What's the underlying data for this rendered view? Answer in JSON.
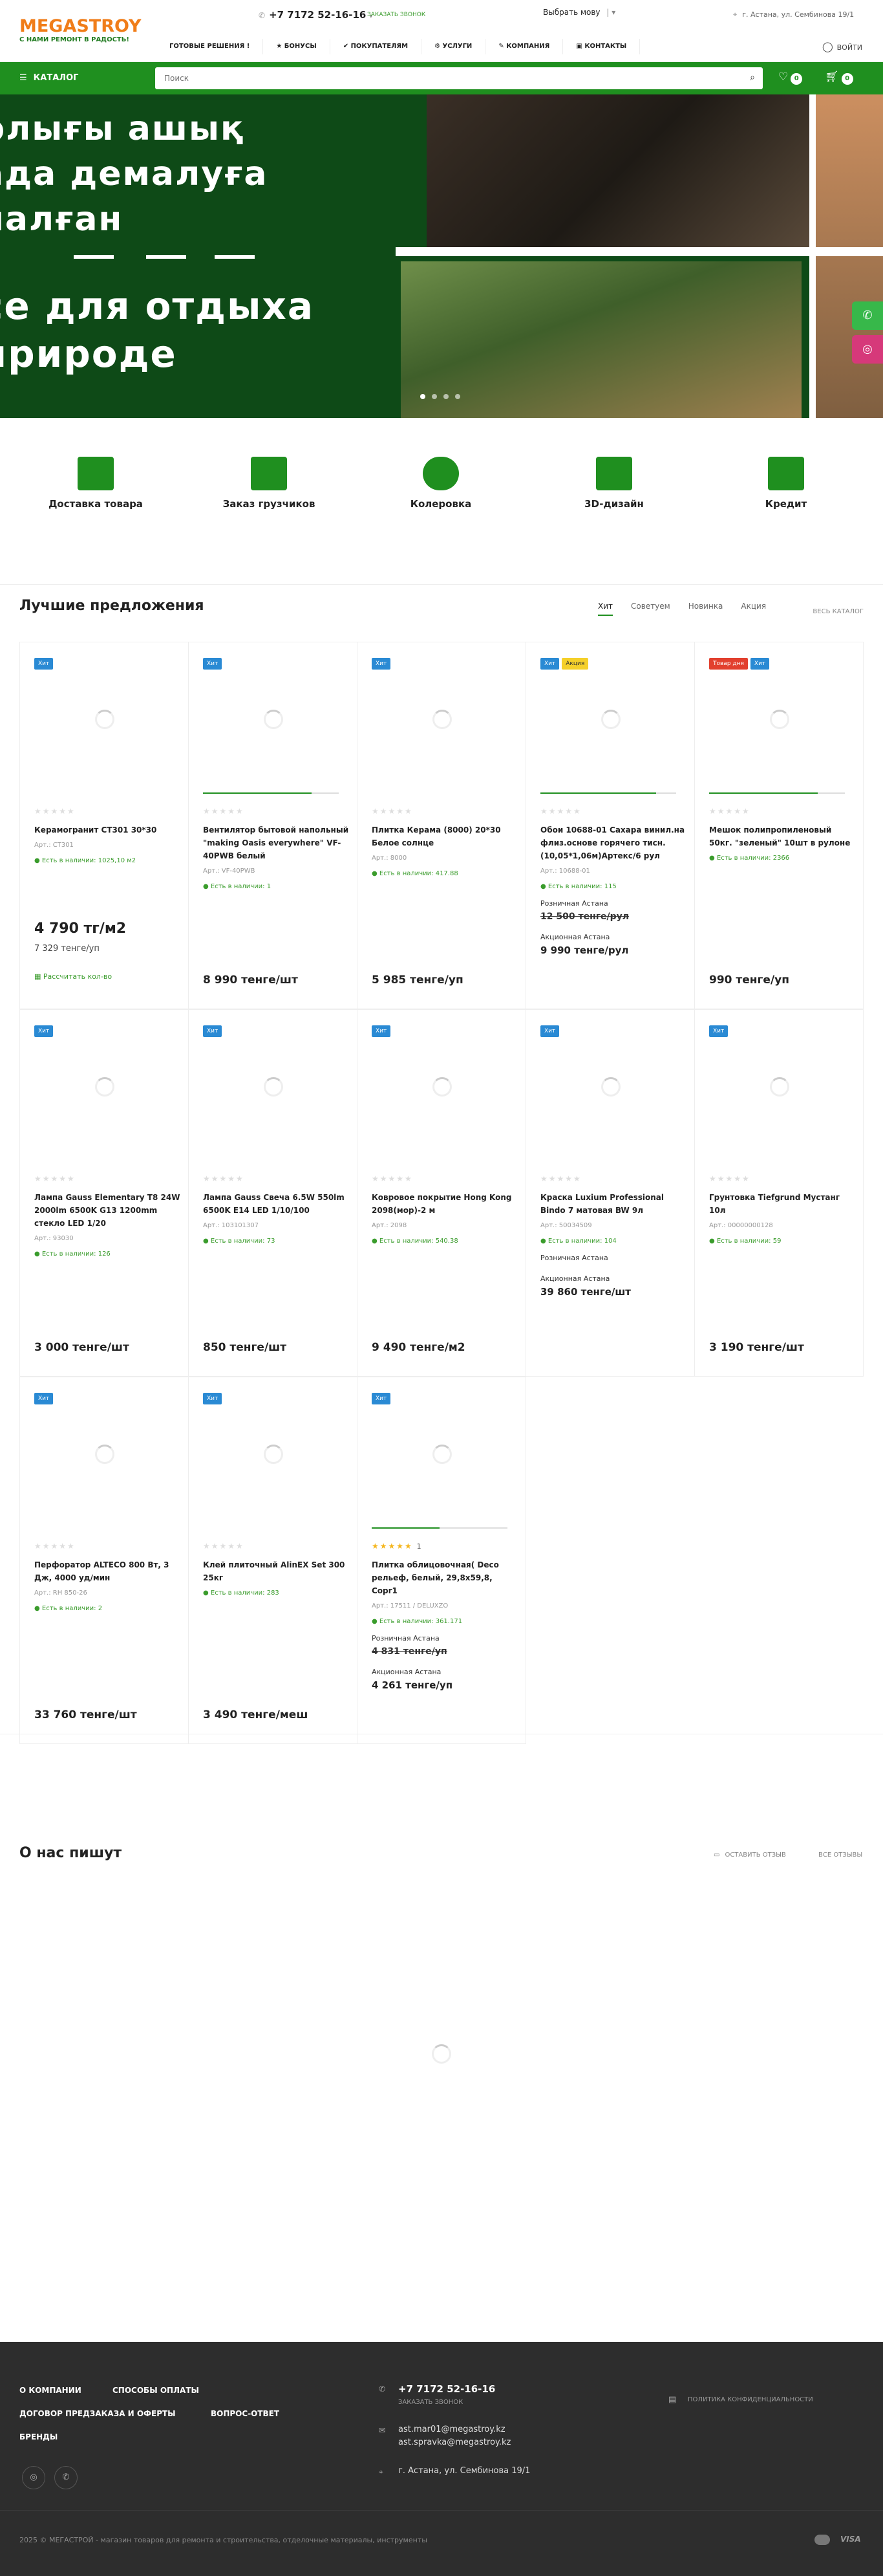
{
  "header": {
    "logo_title": "MEGASTROY",
    "logo_sub": "С НАМИ РЕМОНТ В РАДОСТЬ!",
    "phone": "+7 7172 52-16-16",
    "callback": "заказать звонок",
    "lang": "Выбрать мову",
    "address": "г. Астана, ул. Сембинова 19/1",
    "nav": [
      "ГОТОВЫЕ РЕШЕНИЯ !",
      "БОНУСЫ",
      "ПОКУПАТЕЛЯМ",
      "УСЛУГИ",
      "КОМПАНИЯ",
      "КОНТАКТЫ"
    ],
    "login": "Войти"
  },
  "bar": {
    "catalog": "КАТАЛОГ",
    "search_placeholder": "Поиск",
    "fav_count": "0",
    "cart_count": "0"
  },
  "banner": {
    "line1": "рлығы ашық",
    "line2": "ада демалуға",
    "line3": "налған",
    "line4": "се для отдыха",
    "line5": "природе",
    "slides": 4,
    "active_slide": 1
  },
  "services": [
    "Доставка товара",
    "Заказ грузчиков",
    "Колеровка",
    "3D-дизайн",
    "Кредит"
  ],
  "offers": {
    "title": "Лучшие предложения",
    "tabs": [
      "Хит",
      "Советуем",
      "Новинка",
      "Акция"
    ],
    "all_link": "Весь каталог",
    "products": [
      {
        "tags": [
          [
            "hit",
            "Хит"
          ]
        ],
        "name": "Керамогранит CT301 30*30",
        "art": "Арт.: CT301",
        "stock": "Есть в наличии: 1025,10 м2",
        "price": "4 790 тг/м2",
        "sub": "7 329 тенге/уп",
        "calc": "Рассчитать кол-во"
      },
      {
        "tags": [
          [
            "hit",
            "Хит"
          ]
        ],
        "name": "Вентилятор бытовой напольный \"making Oasis everywhere\" VF-40PWB белый",
        "art": "Арт.: VF-40PWB",
        "stock": "Есть в наличии: 1",
        "price": "8 990 тенге/шт",
        "line": 0.8
      },
      {
        "tags": [
          [
            "hit",
            "Хит"
          ]
        ],
        "name": "Плитка Керама (8000) 20*30 Белое солнце",
        "art": "Арт.: 8000",
        "stock": "Есть в наличии: 417.88",
        "price": "5 985 тенге/уп"
      },
      {
        "tags": [
          [
            "hit",
            "Хит"
          ],
          [
            "promo",
            "Акция"
          ]
        ],
        "name": "Обои 10688-01 Сахара винил.на флиз.основе горячего тисн. (10,05*1,06м)Артекс/6 рул",
        "art": "Арт.: 10688-01",
        "stock": "Есть в наличии: 115",
        "retail_label": "Розничная Астана",
        "old": "12 500 тенге/рул",
        "promo_label": "Акционная Астана",
        "price": "9 990 тенге/рул",
        "line": 0.85
      },
      {
        "tags": [
          [
            "day",
            "Товар дня"
          ],
          [
            "hit",
            "Хит"
          ]
        ],
        "name": "Мешок полипропиленовый 50кг. \"зеленый\" 10шт в рулоне",
        "art": "",
        "stock": "Есть в наличии: 2366",
        "price": "990 тенге/уп",
        "line": 0.8
      },
      {
        "tags": [
          [
            "hit",
            "Хит"
          ]
        ],
        "name": "Лампа Gauss Elementary T8 24W 2000lm 6500K G13 1200mm стекло LED 1/20",
        "art": "Арт.: 93030",
        "stock": "Есть в наличии: 126",
        "price": "3 000 тенге/шт"
      },
      {
        "tags": [
          [
            "hit",
            "Хит"
          ]
        ],
        "name": "Лампа Gauss Свеча 6.5W 550lm 6500K E14 LED 1/10/100",
        "art": "Арт.: 103101307",
        "stock": "Есть в наличии: 73",
        "price": "850 тенге/шт"
      },
      {
        "tags": [
          [
            "hit",
            "Хит"
          ]
        ],
        "name": "Ковровое покрытие Hong Kong 2098(мор)-2 м",
        "art": "Арт.: 2098",
        "stock": "Есть в наличии: 540.38",
        "price": "9 490 тенге/м2"
      },
      {
        "tags": [
          [
            "hit",
            "Хит"
          ]
        ],
        "name": "Краска Luxium Professional Bindo 7 матовая BW 9л",
        "art": "Арт.: 50034509",
        "stock": "Есть в наличии: 104",
        "retail_label": "Розничная Астана",
        "old": "",
        "promo_label": "Акционная Астана",
        "price": "39 860 тенге/шт"
      },
      {
        "tags": [
          [
            "hit",
            "Хит"
          ]
        ],
        "name": "Грунтовка Tiefgrund Мустанг 10л",
        "art": "Арт.: 00000000128",
        "stock": "Есть в наличии: 59",
        "price": "3 190 тенге/шт"
      },
      {
        "tags": [
          [
            "hit",
            "Хит"
          ]
        ],
        "name": "Перфоратор ALTECO 800 Вт, 3 Дж, 4000 уд/мин",
        "art": "Арт.: RH 850-26",
        "stock": "Есть в наличии: 2",
        "price": "33 760 тенге/шт"
      },
      {
        "tags": [
          [
            "hit",
            "Хит"
          ]
        ],
        "name": "Клей плиточный AlinEX Set 300 25кг",
        "art": "",
        "stock": "Есть в наличии: 283",
        "price": "3 490 тенге/меш"
      },
      {
        "tags": [
          [
            "hit",
            "Хит"
          ]
        ],
        "name": "Плитка облицовочная( Deco рельеф, белый, 29,8x59,8, Copr1",
        "art": "Арт.: 17511 / DELUXZO",
        "stock": "Есть в наличии: 361.171",
        "retail_label": "Розничная Астана",
        "old": "4 831 тенге/уп",
        "promo_label": "Акционная Астана",
        "price": "4 261 тенге/уп",
        "rating": "1",
        "line": 0.5
      }
    ]
  },
  "reviews": {
    "title": "О нас пишут",
    "leave": "Оставить отзыв",
    "all": "Все отзывы"
  },
  "footer": {
    "links1": [
      "О КОМПАНИИ",
      "СПОСОБЫ ОПЛАТЫ"
    ],
    "links2": [
      "ДОГОВОР ПРЕДЗАКАЗА И ОФЕРТЫ",
      "ВОПРОС-ОТВЕТ"
    ],
    "links3": [
      "БРЕНДЫ"
    ],
    "phone": "+7 7172 52-16-16",
    "callback": "заказать звонок",
    "email1": "ast.mar01@megastroy.kz",
    "email2": "ast.spravka@megastroy.kz",
    "address": "г. Астана, ул. Сембинова 19/1",
    "privacy": "Политика конфиденциальности",
    "copyright": "2025 © МЕГАСТРОЙ - магазин товаров для ремонта и строительства, отделочные материалы, инструменты",
    "pay": "VISA"
  },
  "colors": {
    "brand_green": "#1f8f1f",
    "logo_orange": "#f07d19",
    "hit_blue": "#2a8ad4",
    "footer_bg": "#2d2d2d"
  }
}
